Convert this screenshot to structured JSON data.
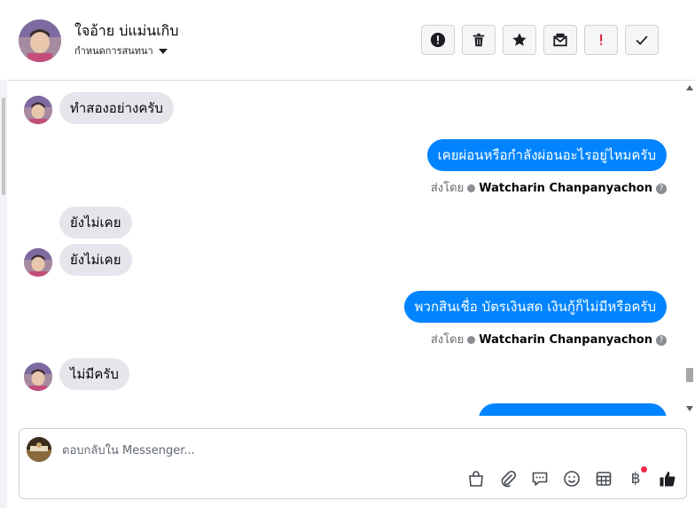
{
  "header": {
    "name": "ใจอ้าย บ่แม่นเกิบ",
    "subtitle": "กำหนดการสนทนา",
    "actions": [
      {
        "icon": "alert-circle-icon"
      },
      {
        "icon": "trash-icon"
      },
      {
        "icon": "star-icon"
      },
      {
        "icon": "mail-open-icon"
      },
      {
        "icon": "exclamation-icon",
        "color": "#e41e3f"
      },
      {
        "icon": "check-icon"
      }
    ]
  },
  "messages": [
    {
      "dir": "in",
      "text": "ทำสองอย่างครับ"
    },
    {
      "dir": "out",
      "text": "เคยผ่อนหรือกำลังผ่อนอะไรอยู่ไหมครับ",
      "sent_by_label": "ส่งโดย",
      "sender": "Watcharin Chanpanyachon"
    },
    {
      "dir": "in",
      "text": "ยังไม่เคย"
    },
    {
      "dir": "in",
      "text": "ยังไม่เคย"
    },
    {
      "dir": "out",
      "text": "พวกสินเชื่อ บัตรเงินสด เงินกู้ก็ไม่มีหรือครับ",
      "sent_by_label": "ส่งโดย",
      "sender": "Watcharin Chanpanyachon"
    },
    {
      "dir": "in",
      "text": "ไม่มีครับ"
    }
  ],
  "composer": {
    "placeholder": "ตอบกลับใน Messenger...",
    "tools": [
      "shopping-bag-icon",
      "paperclip-icon",
      "chat-bubble-icon",
      "emoji-icon",
      "table-icon",
      "baht-icon",
      "thumbs-up-icon"
    ],
    "baht_symbol": "฿"
  },
  "colors": {
    "accent": "#0084ff",
    "incoming_bubble": "#e4e6eb",
    "alert_red": "#e41e3f",
    "notification_dot": "#f02849"
  }
}
